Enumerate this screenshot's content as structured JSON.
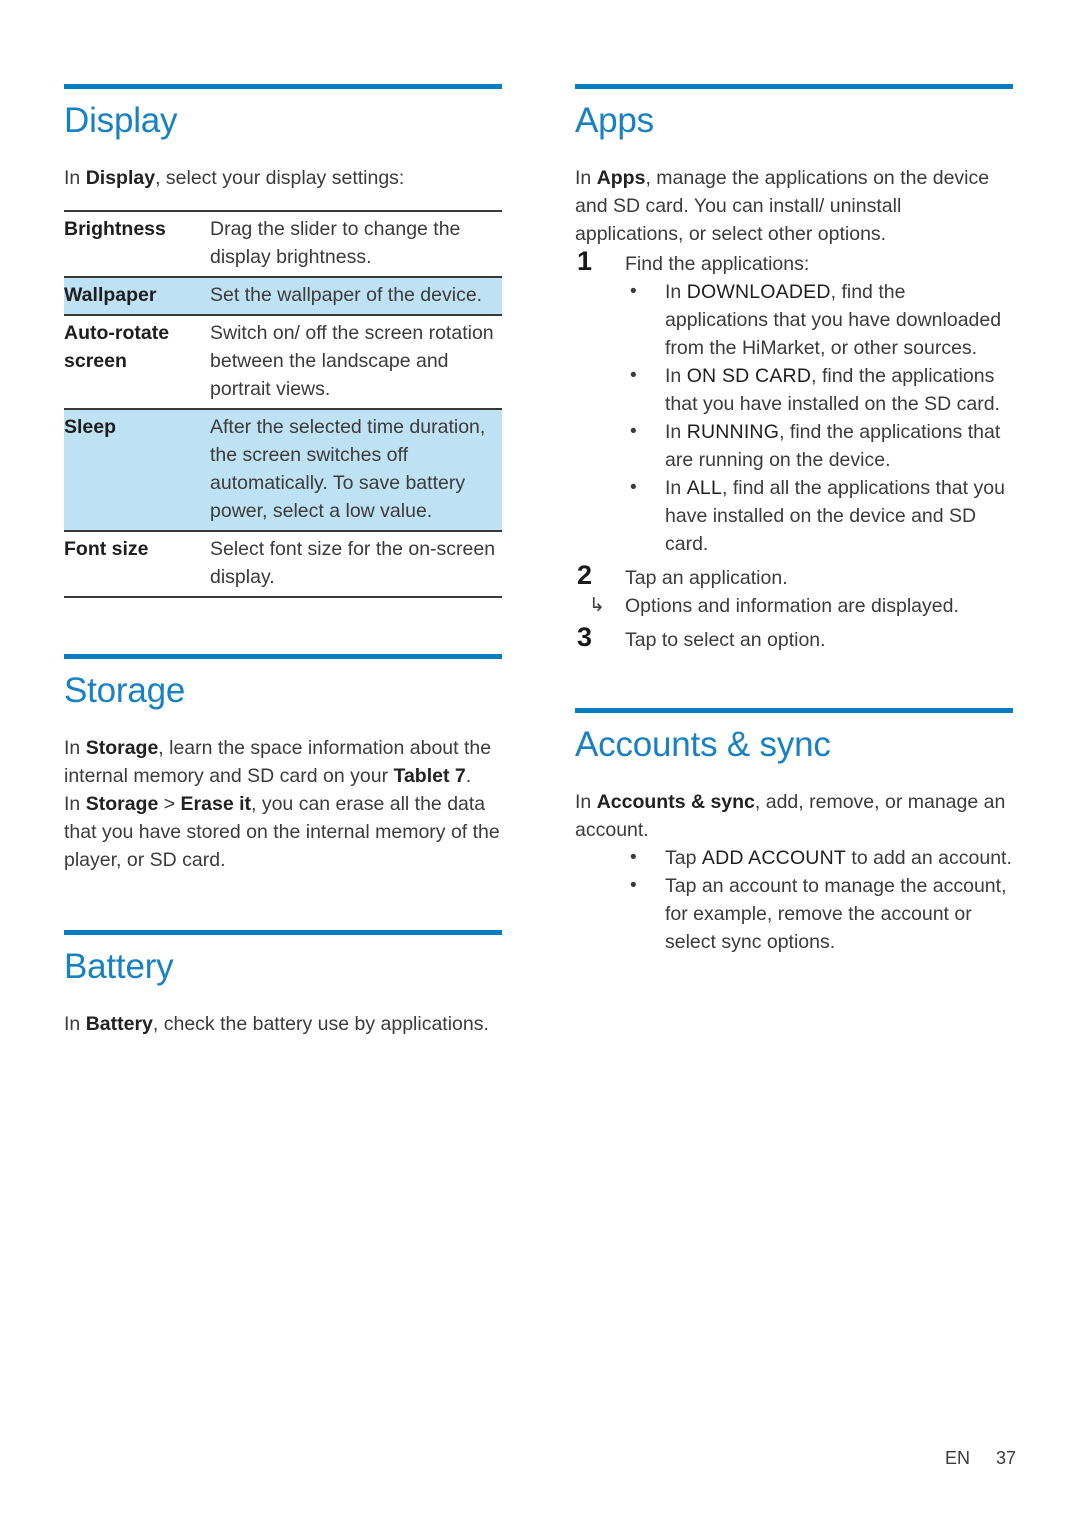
{
  "colors": {
    "heading_blue": "#1881c4",
    "rule_blue": "#0a7cc1",
    "row_highlight": "#bfe1f4",
    "body_text": "#3b3b3b"
  },
  "left_column": {
    "display_section": {
      "title": "Display",
      "intro": {
        "lead": "In ",
        "bold": "Display",
        "rest": ", select your display settings:"
      },
      "table": {
        "rows": [
          {
            "term": "Brightness",
            "definition": "Drag the slider to change the display brightness.",
            "highlighted": false
          },
          {
            "term": "Wallpaper",
            "definition": "Set the wallpaper of the device.",
            "highlighted": true
          },
          {
            "term": "Auto-rotate screen",
            "definition": "Switch on/ off the screen rotation between the landscape and portrait views.",
            "highlighted": false
          },
          {
            "term": "Sleep",
            "definition": "After the selected time duration, the screen switches off automatically. To save battery power, select a low value.",
            "highlighted": true
          },
          {
            "term": "Font size",
            "definition": "Select font size for the on-screen display.",
            "highlighted": false
          }
        ]
      }
    },
    "storage_section": {
      "title": "Storage",
      "paragraph_1": {
        "lead": "In ",
        "bold": "Storage",
        "mid": ", learn the space information about the internal memory and SD card on your ",
        "bold2": "Tablet 7",
        "rest": "."
      },
      "paragraph_2": {
        "lead": "In ",
        "bold": "Storage",
        "mid": " > ",
        "bold2": "Erase it",
        "rest": ", you can erase all the data that you have stored on the internal memory of the player, or SD card."
      }
    },
    "battery_section": {
      "title": "Battery",
      "paragraph": {
        "lead": "In ",
        "bold": "Battery",
        "rest": ", check the battery use by applications."
      }
    }
  },
  "right_column": {
    "apps_section": {
      "title": "Apps",
      "intro": {
        "lead": "In ",
        "bold": "Apps",
        "rest": ", manage the applications on the device and SD card. You can install/ uninstall applications, or select other options."
      },
      "steps": [
        {
          "number": "1",
          "text": "Find the applications:"
        },
        {
          "number": "2",
          "text": "Tap an application."
        },
        {
          "number": "3",
          "text": "Tap to select an option."
        }
      ],
      "find_bullets": [
        {
          "lead": "In ",
          "caps": "DOWNLOADED",
          "rest": ", find the applications that you have downloaded from the HiMarket, or other sources."
        },
        {
          "lead": "In ",
          "caps": "ON SD CARD",
          "rest": ", find the applications that you have installed on the SD card."
        },
        {
          "lead": "In ",
          "caps": "RUNNING",
          "rest": ", find the applications that are running on the device."
        },
        {
          "lead": "In ",
          "caps": "ALL",
          "rest": ", find all the applications that you have installed on the device and SD card."
        }
      ],
      "substep_arrow": "↳",
      "substep_text": "Options and information are displayed."
    },
    "accounts_section": {
      "title": "Accounts & sync",
      "intro": {
        "lead": "In ",
        "bold": "Accounts & sync",
        "rest": ", add, remove, or manage an account."
      },
      "bullets": [
        {
          "lead": "Tap ",
          "caps": "ADD ACCOUNT",
          "rest": " to add an account."
        },
        {
          "lead": "Tap an account to manage the account, for example, remove the account or select sync options.",
          "caps": "",
          "rest": ""
        }
      ],
      "bullet_glyph": "•"
    }
  },
  "footer": {
    "language": "EN",
    "page_number": "37"
  }
}
